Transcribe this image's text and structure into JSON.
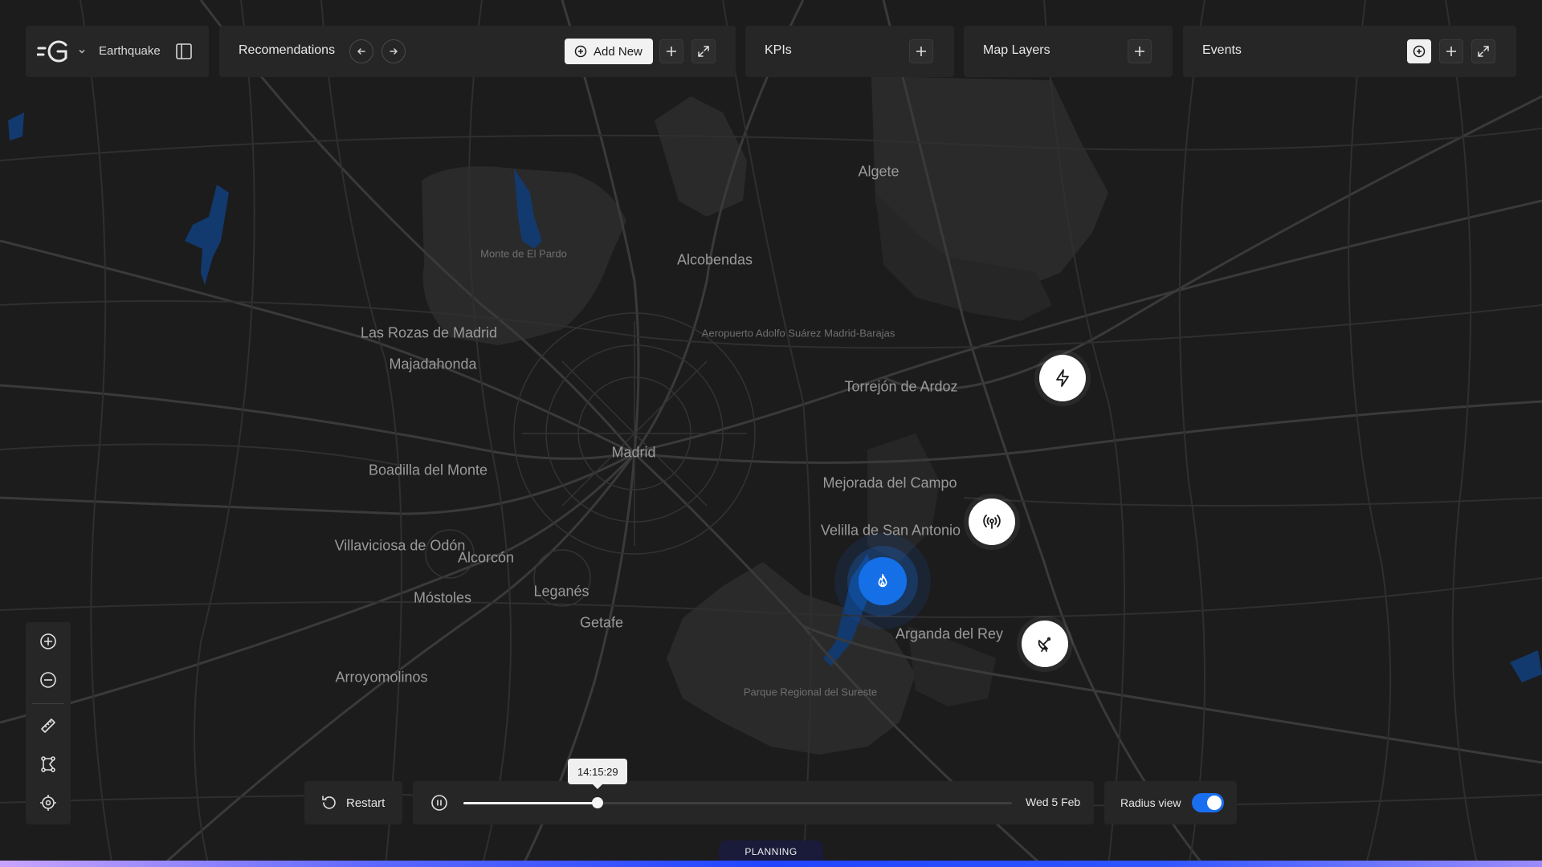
{
  "header": {
    "scenario": {
      "label": "Earthquake"
    },
    "recommendations": {
      "title": "Recomendations",
      "add_new_label": "Add New"
    },
    "kpis": {
      "title": "KPIs"
    },
    "map_layers": {
      "title": "Map Layers"
    },
    "events": {
      "title": "Events"
    }
  },
  "map": {
    "labels": [
      {
        "id": "algete",
        "text": "Algete"
      },
      {
        "id": "monte-de-el-pardo",
        "text": "Monte de El Pardo"
      },
      {
        "id": "alcobendas",
        "text": "Alcobendas"
      },
      {
        "id": "las-rozas",
        "text": "Las Rozas de Madrid"
      },
      {
        "id": "aeropuerto",
        "text": "Aeropuerto Adolfo Suárez Madrid-Barajas"
      },
      {
        "id": "majadahonda",
        "text": "Majadahonda"
      },
      {
        "id": "torrejon",
        "text": "Torrejón de Ardoz"
      },
      {
        "id": "madrid",
        "text": "Madrid"
      },
      {
        "id": "boadilla",
        "text": "Boadilla del Monte"
      },
      {
        "id": "mejorada",
        "text": "Mejorada del Campo"
      },
      {
        "id": "velilla",
        "text": "Velilla de San Antonio"
      },
      {
        "id": "villaviciosa",
        "text": "Villaviciosa de Odón"
      },
      {
        "id": "alcorcon",
        "text": "Alcorcón"
      },
      {
        "id": "leganes",
        "text": "Leganés"
      },
      {
        "id": "mostoles",
        "text": "Móstoles"
      },
      {
        "id": "getafe",
        "text": "Getafe"
      },
      {
        "id": "arganda",
        "text": "Arganda del Rey"
      },
      {
        "id": "arroyomolinos",
        "text": "Arroyomolinos"
      },
      {
        "id": "parque-sureste",
        "text": "Parque Regional del Sureste"
      }
    ],
    "markers": [
      {
        "id": "power",
        "icon": "lightning-icon"
      },
      {
        "id": "antenna",
        "icon": "broadcast-icon"
      },
      {
        "id": "fire",
        "icon": "flame-icon",
        "active": true
      },
      {
        "id": "dish",
        "icon": "satellite-dish-icon"
      }
    ]
  },
  "timeline": {
    "restart_label": "Restart",
    "current_time": "14:15:29",
    "date": "Wed 5 Feb",
    "progress": 0.245,
    "radius_view_label": "Radius view",
    "radius_view_on": true
  },
  "mode": {
    "label": "PLANNING"
  },
  "colors": {
    "accent": "#1570e8",
    "panel": "#262627",
    "background": "#1c1c1d"
  }
}
